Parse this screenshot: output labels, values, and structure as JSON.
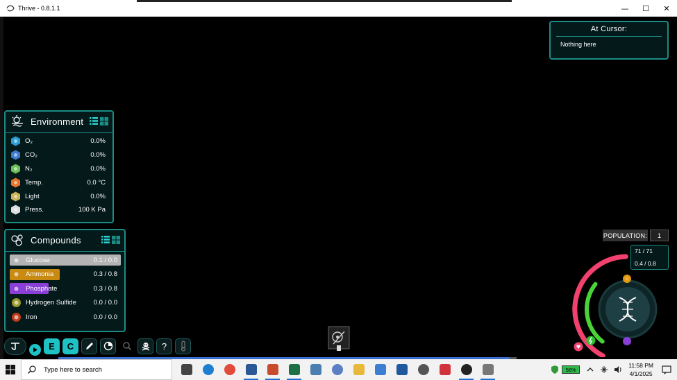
{
  "window": {
    "title": "Thrive - 0.8.1.1",
    "minimize": "—",
    "maximize": "☐",
    "close": "✕"
  },
  "cursor_panel": {
    "title": "At Cursor:",
    "text": "Nothing here"
  },
  "environment": {
    "title": "Environment",
    "rows": [
      {
        "label": "O₂",
        "value": "0.0%",
        "icon": "oxygen-icon",
        "color": "#2a9fd6"
      },
      {
        "label": "CO₂",
        "value": "0.0%",
        "icon": "carbon-dioxide-icon",
        "color": "#3b7bd0"
      },
      {
        "label": "N₂",
        "value": "0.0%",
        "icon": "nitrogen-icon",
        "color": "#6bbf59"
      },
      {
        "label": "Temp.",
        "value": "0.0 °C",
        "icon": "temperature-icon",
        "color": "#e8732a"
      },
      {
        "label": "Light",
        "value": "0.0%",
        "icon": "light-icon",
        "color": "#c9b458"
      },
      {
        "label": "Press.",
        "value": "100 K Pa",
        "icon": "pressure-icon",
        "color": "#dddddd"
      }
    ]
  },
  "compounds": {
    "title": "Compounds",
    "rows": [
      {
        "label": "Glucose",
        "value": "0.1 / 0.0",
        "icon": "glucose-icon",
        "bar_color": "#b4b4b4",
        "fill": 1.0
      },
      {
        "label": "Ammonia",
        "value": "0.3 / 0.8",
        "icon": "ammonia-icon",
        "bar_color": "#c98a12",
        "fill": 0.45
      },
      {
        "label": "Phosphate",
        "value": "0.3 / 0.8",
        "icon": "phosphate-icon",
        "bar_color": "#8a3fd6",
        "fill": 0.35
      },
      {
        "label": "Hydrogen Sulfide",
        "value": "0.0 / 0.0",
        "icon": "hydrogen-sulfide-icon",
        "bar_color": "#9a9a2a",
        "fill": 0
      },
      {
        "label": "Iron",
        "value": "0.0 / 0.0",
        "icon": "iron-icon",
        "bar_color": "#c0391b",
        "fill": 0
      }
    ]
  },
  "toolbar": {
    "editor_label": "E",
    "compound_label": "C",
    "help_label": "?"
  },
  "population": {
    "label": "POPULATION:",
    "value": "1"
  },
  "health": {
    "hp": "71 / 71",
    "atp": "0.4 / 0.8",
    "hp_fraction": 1.0,
    "atp_fraction": 0.5,
    "hp_color": "#f2416f",
    "atp_color": "#4ad336"
  },
  "taskbar": {
    "search_placeholder": "Type here to search",
    "battery": "56%",
    "time": "11:58 PM",
    "date": "4/1/2025",
    "apps": [
      "task-view-icon",
      "edge-icon",
      "chrome-icon",
      "word-icon",
      "powerpoint-icon",
      "excel-icon",
      "notepad-icon",
      "r-icon",
      "file-explorer-icon",
      "home-icon",
      "ucm-icon",
      "circle-app-icon",
      "vivaldi-icon",
      "thrive-icon",
      "windows-app-icon"
    ]
  }
}
